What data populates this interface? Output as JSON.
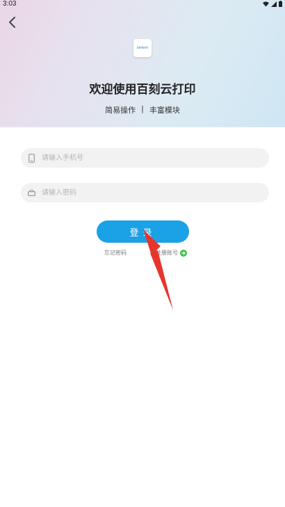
{
  "status_bar": {
    "time": "3:03",
    "icons": [
      "wifi-icon",
      "signal-icon",
      "battery-icon"
    ]
  },
  "header": {
    "back_icon": "chevron-left-icon",
    "logo_text": "beikem",
    "title": "欢迎使用百刻云打印",
    "subtitle_left": "简易操作",
    "subtitle_sep": "|",
    "subtitle_right": "丰富模块"
  },
  "form": {
    "phone_placeholder": "请输入手机号",
    "password_placeholder": "请输入密码",
    "login_label": "登录",
    "forgot_label": "忘记密码",
    "register_label": "注册账号"
  },
  "colors": {
    "accent": "#1aa1e6",
    "annotation": "#e8352c",
    "register_icon": "#3bbf4a"
  }
}
